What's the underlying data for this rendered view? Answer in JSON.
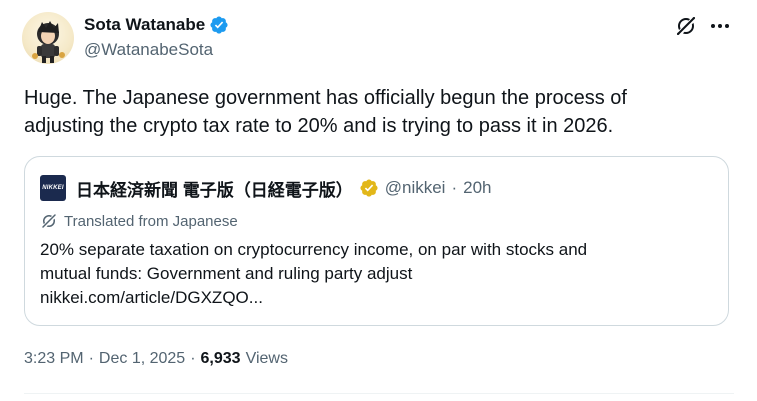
{
  "author": {
    "display_name": "Sota Watanabe",
    "handle": "@WatanabeSota",
    "avatar_icon": "anime-character-avatar",
    "verified_icon": "blue-verified-badge-icon"
  },
  "actions": {
    "grok_icon": "grok-icon",
    "more_icon": "more-options-icon"
  },
  "tweet": {
    "text_line1": "Huge. The Japanese government has officially begun the process of",
    "text_line2": "adjusting the crypto tax rate to 20% and is trying to pass it in 2026."
  },
  "quote": {
    "logo_text": "NIKKEI",
    "name": "日本経済新聞 電子版（日経電子版）",
    "handle": "@nikkei",
    "separator": "·",
    "time": "20h",
    "translated_label": "Translated from Japanese",
    "body_line1": "20% separate taxation on cryptocurrency income, on par with stocks and",
    "body_line2": "mutual funds: Government and ruling party adjust",
    "body_line3": "nikkei.com/article/DGXZQO..."
  },
  "meta": {
    "time": "3:23 PM",
    "sep1": "·",
    "date": "Dec 1, 2025",
    "sep2": "·",
    "views_count": "6,933",
    "views_label": "Views"
  },
  "colors": {
    "verified_blue": "#1d9bf0",
    "verified_gold": "#e2b719",
    "muted_text": "#536471",
    "border": "#cfd9de"
  }
}
